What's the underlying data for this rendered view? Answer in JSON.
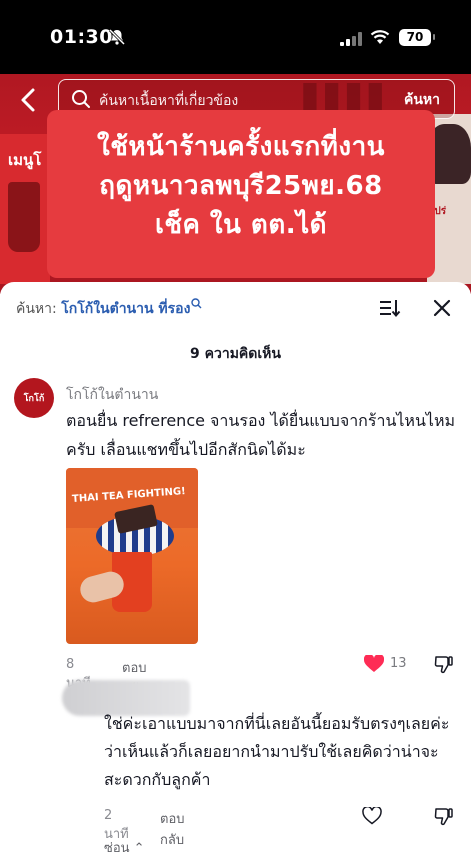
{
  "status_bar": {
    "time": "01:30",
    "battery": "70"
  },
  "search": {
    "placeholder": "ค้นหาเนื้อหาที่เกี่ยวข้อง",
    "button": "ค้นหา"
  },
  "video": {
    "left_sign": "เมนูโ",
    "right_sign": "โปร่",
    "caption_lines": [
      "ใช้หน้าร้านครั้งแรกที่งาน",
      "ฤดูหนาวลพบุรี25พย.68",
      "เช็ค ใน ตต.ได้"
    ]
  },
  "sheet": {
    "search_label": "ค้นหา:",
    "search_term": "โกโก้ในตำนาน ที่รอง",
    "comment_count": "9 ความคิดเห็น"
  },
  "comment": {
    "avatar_text": "โกโก้",
    "username": "โกโก้ในตำนาน",
    "text": "ตอนยื่น refrerence จานรอง ได้ยื่นแบบจากร้านไหนไหมครับ เลื่อนแชทขึ้นไปอีกสักนิดได้มะ",
    "photo_text": "THAI TEA FIGHTING!",
    "time": "8 นาที",
    "reply_label": "ตอบกลับ",
    "likes": "13"
  },
  "reply": {
    "text": "ใช่ค่ะเอาแบบมาจากที่นี่เลยอันนี้ยอมรับตรงๆเลยค่ะว่าเห็นแล้วก็เลยอยากนำมาปรับใช้เลยคิดว่าน่าจะสะดวกกับลูกค้า",
    "time": "2 นาที",
    "reply_label": "ตอบกลับ",
    "hide_label": "ซ่อน"
  },
  "colors": {
    "accent_link": "#2b5db0",
    "like_red": "#fe2c55",
    "banner_red": "#e63b3f"
  }
}
